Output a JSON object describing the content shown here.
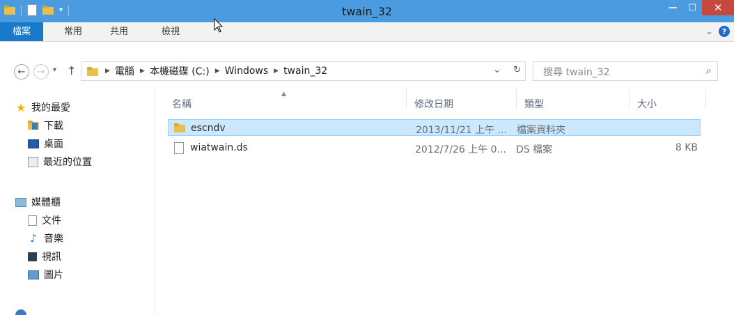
{
  "window": {
    "title": "twain_32"
  },
  "ribbon": {
    "tabs": [
      "檔案",
      "常用",
      "共用",
      "檢視"
    ],
    "expand_glyph": "⌄",
    "help_glyph": "?"
  },
  "titlebar_controls": {
    "minimize": "—",
    "maximize": "☐",
    "close": "✕"
  },
  "address": {
    "back_glyph": "←",
    "forward_glyph": "→",
    "recent_glyph": "▾",
    "up_glyph": "↑",
    "separator": "▶",
    "path": [
      "電腦",
      "本機磁碟 (C:)",
      "Windows",
      "twain_32"
    ],
    "dropdown_glyph": "⌄",
    "refresh_glyph": "↻"
  },
  "search": {
    "placeholder": "搜尋 twain_32",
    "icon_glyph": "⌕"
  },
  "sidebar": {
    "favorites": {
      "label": "我的最愛",
      "icon": "star-icon"
    },
    "favorite_items": [
      {
        "label": "下載",
        "icon": "downloads-icon"
      },
      {
        "label": "桌面",
        "icon": "desktop-icon"
      },
      {
        "label": "最近的位置",
        "icon": "recent-places-icon"
      }
    ],
    "libraries": {
      "label": "媒體櫃",
      "icon": "libraries-icon"
    },
    "library_items": [
      {
        "label": "文件",
        "icon": "documents-icon"
      },
      {
        "label": "音樂",
        "icon": "music-icon"
      },
      {
        "label": "視訊",
        "icon": "videos-icon"
      },
      {
        "label": "圖片",
        "icon": "pictures-icon"
      }
    ]
  },
  "file_list": {
    "columns": [
      "名稱",
      "修改日期",
      "類型",
      "大小"
    ],
    "sort_glyph": "▲",
    "rows": [
      {
        "name": "escndv",
        "modified": "2013/11/21 上午 ...",
        "type": "檔案資料夾",
        "size": "",
        "icon": "folder-icon",
        "selected": true
      },
      {
        "name": "wiatwain.ds",
        "modified": "2012/7/26 上午 0...",
        "type": "DS 檔案",
        "size": "8 KB",
        "icon": "file-icon",
        "selected": false
      }
    ]
  },
  "colors": {
    "titlebar": "#4a9be0",
    "file_tab": "#1979ca",
    "close": "#c7483e",
    "selection": "#cce8ff",
    "folder": "#e8c04a"
  }
}
